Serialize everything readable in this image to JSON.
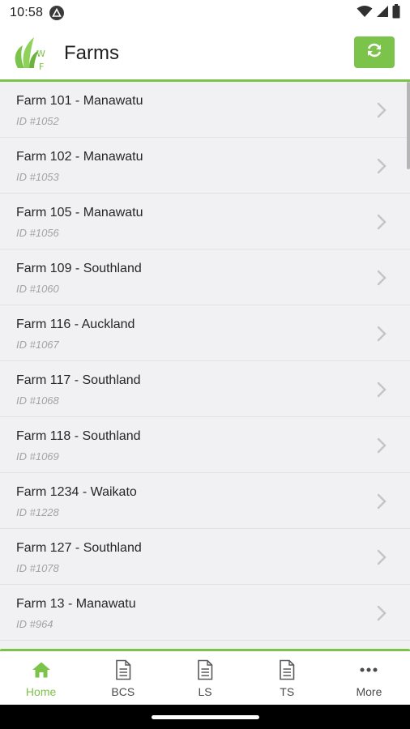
{
  "status_bar": {
    "time": "10:58"
  },
  "header": {
    "title": "Farms",
    "logo_text": "WF"
  },
  "farms": [
    {
      "name": "Farm 101 - Manawatu",
      "id": "ID #1052"
    },
    {
      "name": "Farm 102 - Manawatu",
      "id": "ID #1053"
    },
    {
      "name": "Farm 105 - Manawatu",
      "id": "ID #1056"
    },
    {
      "name": "Farm 109 - Southland",
      "id": "ID #1060"
    },
    {
      "name": "Farm 116 - Auckland",
      "id": "ID #1067"
    },
    {
      "name": "Farm 117 - Southland",
      "id": "ID #1068"
    },
    {
      "name": "Farm 118 - Southland",
      "id": "ID #1069"
    },
    {
      "name": "Farm 1234 - Waikato",
      "id": "ID #1228"
    },
    {
      "name": "Farm 127 - Southland",
      "id": "ID #1078"
    },
    {
      "name": "Farm 13 - Manawatu",
      "id": "ID #964"
    }
  ],
  "tabs": [
    {
      "label": "Home",
      "icon": "home-icon",
      "active": true
    },
    {
      "label": "BCS",
      "icon": "document-icon",
      "active": false
    },
    {
      "label": "LS",
      "icon": "document-icon",
      "active": false
    },
    {
      "label": "TS",
      "icon": "document-icon",
      "active": false
    },
    {
      "label": "More",
      "icon": "more-dots-icon",
      "active": false
    }
  ],
  "colors": {
    "accent": "#7cc34b",
    "list_background": "#f1f1f3",
    "id_text": "#a3a3a3"
  }
}
